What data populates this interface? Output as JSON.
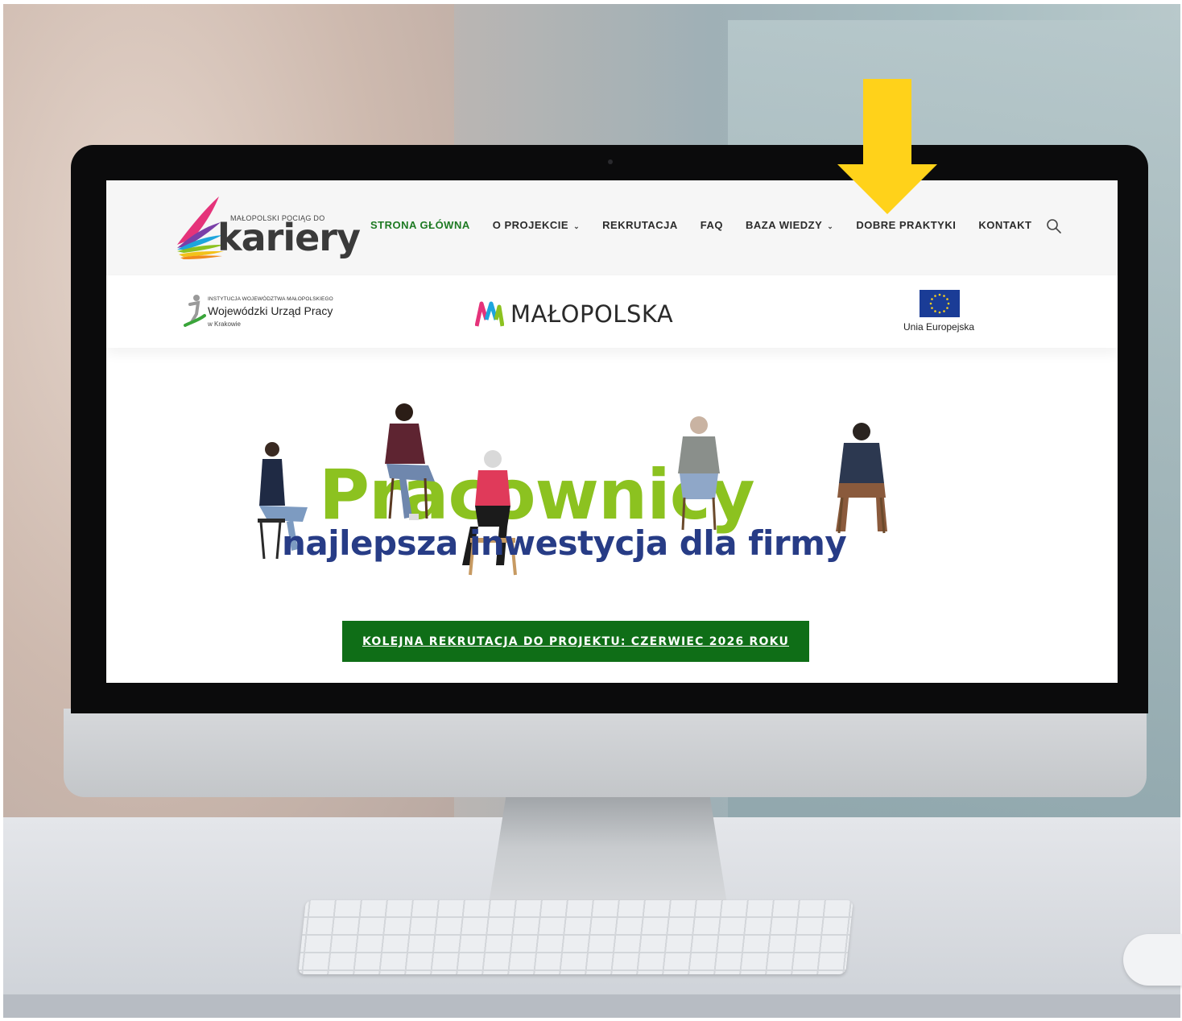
{
  "logo": {
    "small": "MAŁOPOLSKI POCIĄG DO",
    "big": "kariery"
  },
  "nav": {
    "items": [
      {
        "label": "STRONA GŁÓWNA",
        "active": true,
        "dropdown": false
      },
      {
        "label": "O PROJEKCIE",
        "active": false,
        "dropdown": true
      },
      {
        "label": "REKRUTACJA",
        "active": false,
        "dropdown": false
      },
      {
        "label": "FAQ",
        "active": false,
        "dropdown": false
      },
      {
        "label": "BAZA WIEDZY",
        "active": false,
        "dropdown": true
      },
      {
        "label": "DOBRE PRAKTYKI",
        "active": false,
        "dropdown": false
      },
      {
        "label": "KONTAKT",
        "active": false,
        "dropdown": false
      }
    ],
    "search_icon": "search-icon",
    "chevron_glyph": "⌄"
  },
  "partners": {
    "wup": {
      "institution": "INSTYTUCJA WOJEWÓDZTWA MAŁOPOLSKIEGO",
      "name": "Wojewódzki Urząd Pracy",
      "city": "w Krakowie"
    },
    "malopolska": "MAŁOPOLSKA",
    "eu": "Unia Europejska"
  },
  "hero": {
    "headline": "Pracownicy",
    "subline": "najlepsza inwestycja dla firmy",
    "cta": "KOLEJNA REKRUTACJA DO PROJEKTU: CZERWIEC 2026 ROKU"
  },
  "colors": {
    "active_nav": "#1e7a23",
    "headline_green": "#8cc220",
    "subline_navy": "#273c86",
    "cta_green": "#0f6e17",
    "annotation_arrow": "#ffd21a",
    "eu_blue": "#1a3c96",
    "eu_star": "#ffd21a"
  }
}
